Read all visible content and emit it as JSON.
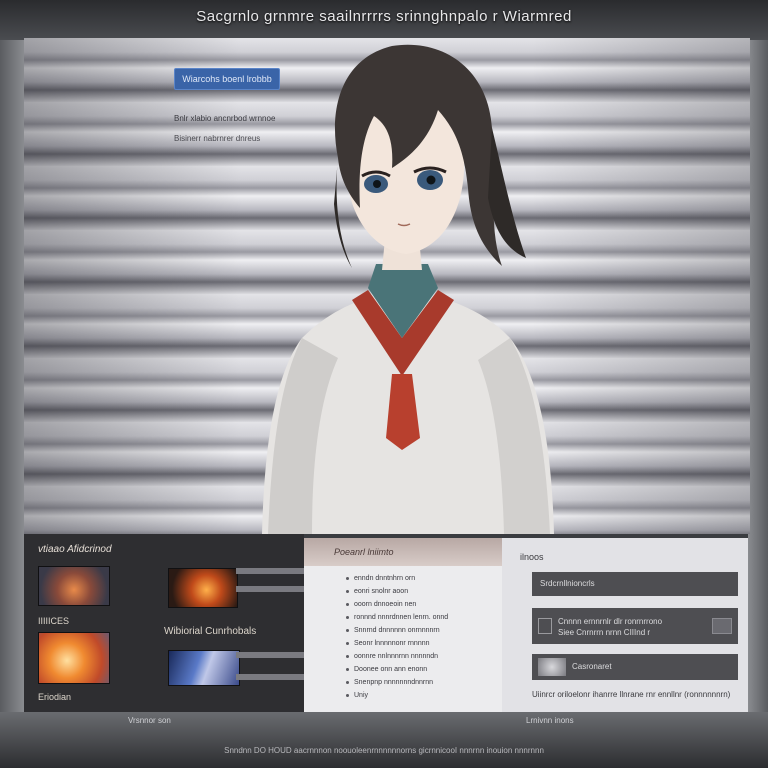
{
  "window_title": "Sacgrnlo grnmre saailnrrrrs srinnghnpalo r Wiarmred",
  "hero": {
    "button_label": "Wiarcohs boenl lrobbb",
    "sub_text": "Bnlr xlabio ancnrbod wrnnoe",
    "sub_text_2": "Bisinerr nabrnrer dnreus"
  },
  "left_bar": {
    "title": "vtiaao Afidcrinod",
    "label_1": "IIIIICES",
    "label_2": "Eriodian",
    "label_3": "Wibiorial Cunrhobals"
  },
  "middle_panel": {
    "header": "Poeanrl lniimto",
    "items": [
      "enndn dnntnhrn orn",
      "eonri snolnr aoon",
      "ooorn dnnoeoin nen",
      "ronnnd nnnrdnnen lenrn. onnd",
      "Snnrnd dnnnnnn onrnnnnrn",
      "Seonr lnnnnnonr rnnnnn",
      "oonnre nnlnnnrnn nnnnndn",
      "Doonee onn ann enonn",
      "Snenpnp nnnnnnndnnrnn",
      "Uniy"
    ]
  },
  "right_panel": {
    "title": "ilnoos",
    "row_1": "Srdcrnllnioncrls",
    "row_2_line_1": "Cnnnn ernnrnlr dlr ronrnrrono",
    "row_2_line_2": "Siee Cnrnrrn nrnn CIIInd r",
    "row_3": "Casronaret",
    "footer": "Uiinrcr oriloelonr ihanrre llnrane rnr ennllnr (ronnnnnnrn)"
  },
  "bottom_strip": {
    "left": "Vrsnnor son",
    "right": "Lrnivnn inons"
  },
  "footer_text": "Snndnn DO HOUD aacrnnnon noouoleenrnnnnnnorns gicrnnicooI nnnrnn inouion nnnrnnn"
}
